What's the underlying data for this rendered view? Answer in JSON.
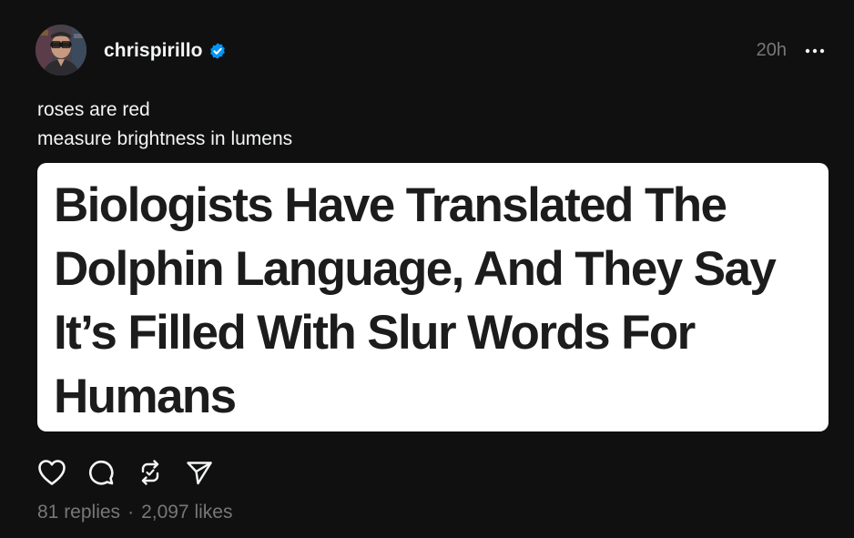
{
  "post": {
    "author": {
      "username": "chrispirillo",
      "verified": true,
      "avatar_icon": "profile-photo"
    },
    "timestamp": "20h",
    "caption_lines": [
      "roses are red",
      "measure brightness in lumens"
    ],
    "image": {
      "headline_lines": [
        "Biologists Have Translated The",
        "Dolphin Language, And They Say",
        "It’s Filled With Slur Words For",
        "Humans"
      ]
    },
    "actions": {
      "like_icon": "heart-icon",
      "reply_icon": "comment-icon",
      "repost_icon": "repost-icon",
      "share_icon": "send-icon"
    },
    "stats": {
      "replies": "81 replies",
      "separator": "·",
      "likes": "2,097 likes"
    }
  },
  "colors": {
    "background": "#101010",
    "text_primary": "#f3f5f7",
    "text_secondary": "#777777",
    "verified_badge": "#0095f6",
    "card_background": "#ffffff",
    "headline_text": "#1c1c1c"
  }
}
